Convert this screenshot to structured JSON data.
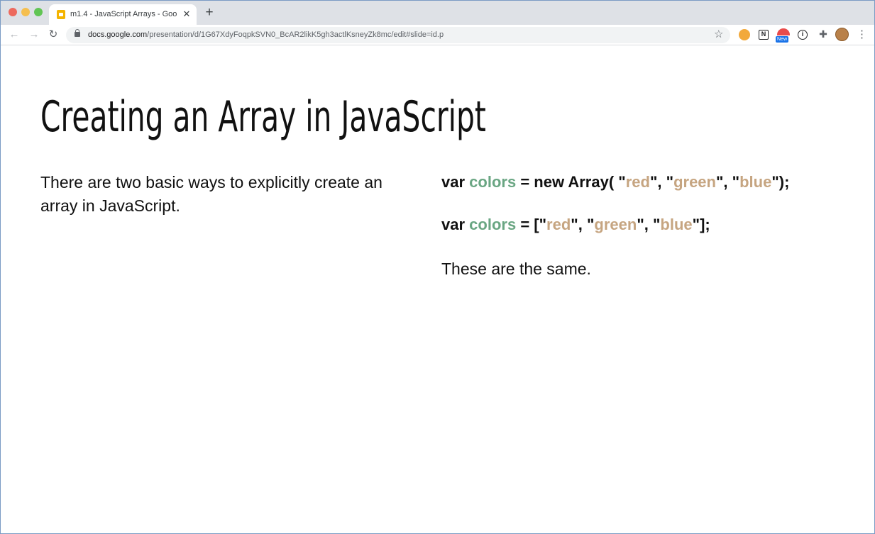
{
  "browser": {
    "tab": {
      "title": "m1.4 - JavaScript Arrays - Goo",
      "close_glyph": "✕"
    },
    "new_tab_glyph": "+",
    "nav": {
      "back_glyph": "←",
      "forward_glyph": "→",
      "reload_glyph": "↻"
    },
    "address": {
      "host": "docs.google.com",
      "path": "/presentation/d/1G67XdyFoqpkSVN0_BcAR2likK5gh3actlKsneyZk8mc/edit#slide=id.p",
      "bookmark_glyph": "☆"
    },
    "extensions": {
      "notion_glyph": "N",
      "new_badge": "New",
      "onepassword_glyph": "i",
      "puzzle_glyph": "✚",
      "menu_glyph": "⋮"
    }
  },
  "slide": {
    "title": "Creating an Array in JavaScript",
    "body": "There are two basic ways to explicitly create an array in JavaScript.",
    "code1": {
      "var": "var",
      "ident": "colors",
      "mid": " = new Array( \"",
      "s1": "red",
      "sep1": "\", \"",
      "s2": "green",
      "sep2": "\", \"",
      "s3": "blue",
      "end": "\");"
    },
    "code2": {
      "var": "var",
      "ident": "colors",
      "mid": " = [\"",
      "s1": "red",
      "sep1": "\", \"",
      "s2": "green",
      "sep2": "\", \"",
      "s3": "blue",
      "end": "\"];"
    },
    "note": "These are the same."
  },
  "colors": {
    "identifier": "#6aa683",
    "string": "#c6a581",
    "text": "#111111"
  }
}
